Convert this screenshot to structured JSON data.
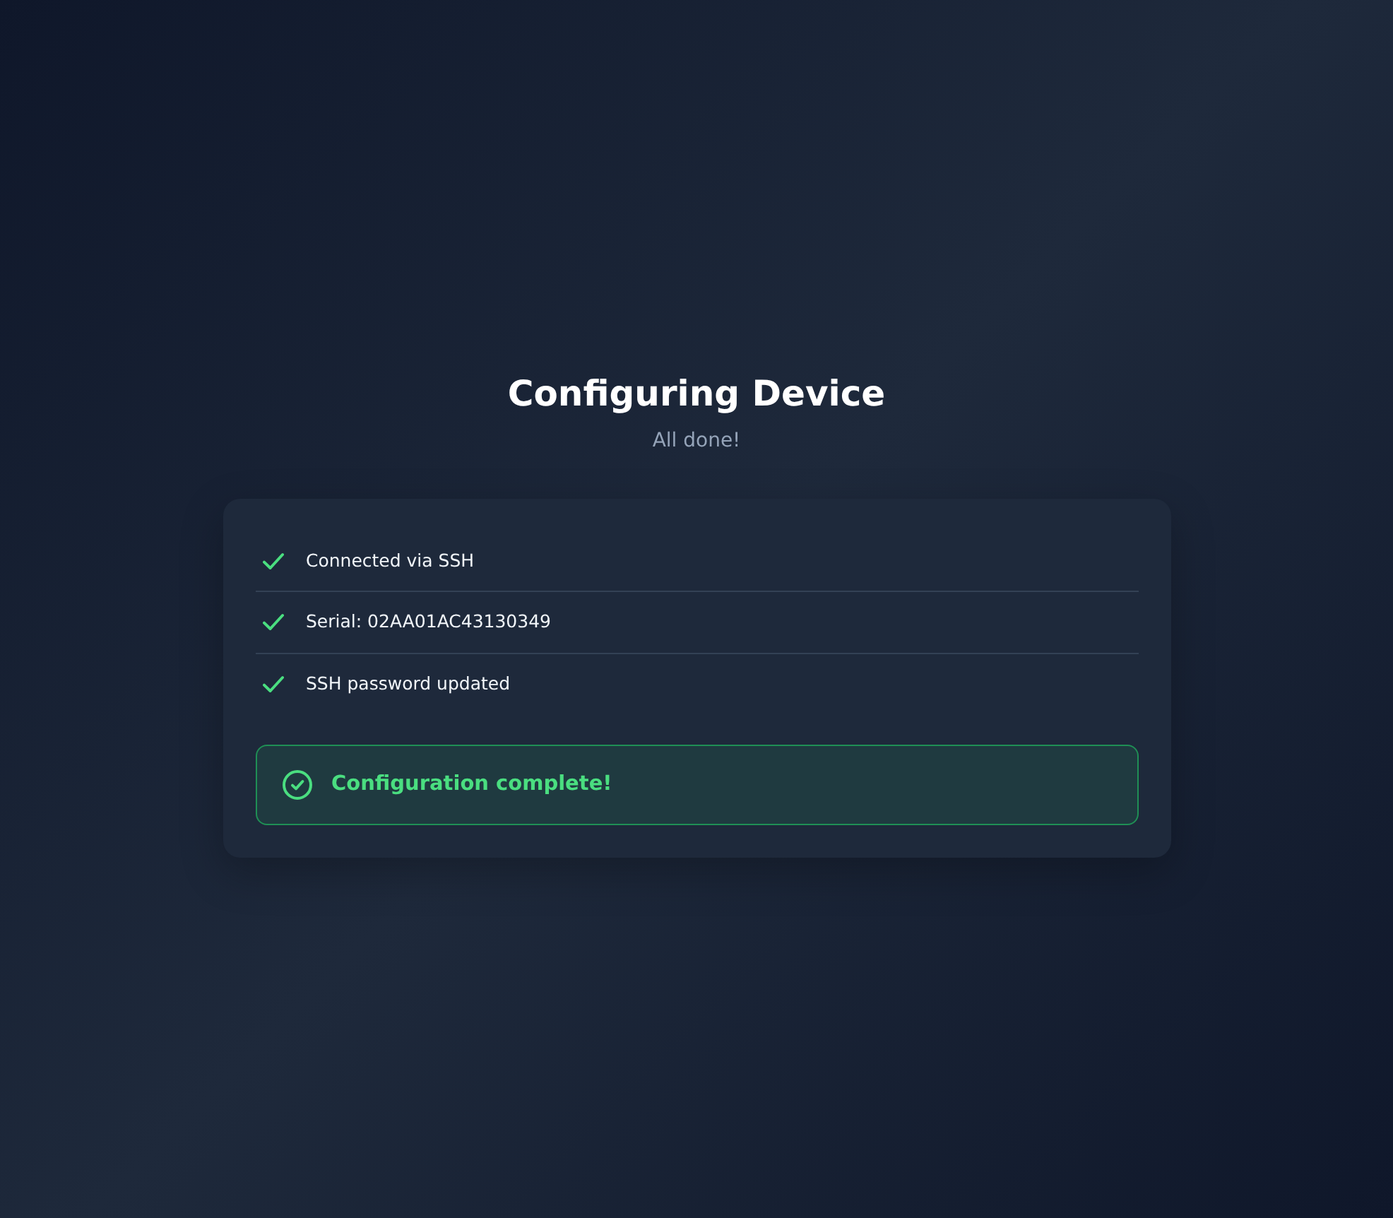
{
  "title": "Configuring Device",
  "subtitle": "All done!",
  "steps": [
    {
      "label": "Connected via SSH",
      "done": true
    },
    {
      "label": "Serial: 02AA01AC43130349",
      "done": true
    },
    {
      "label": "SSH password updated",
      "done": true
    }
  ],
  "result": {
    "kind": "success",
    "message": "Configuration complete!"
  }
}
